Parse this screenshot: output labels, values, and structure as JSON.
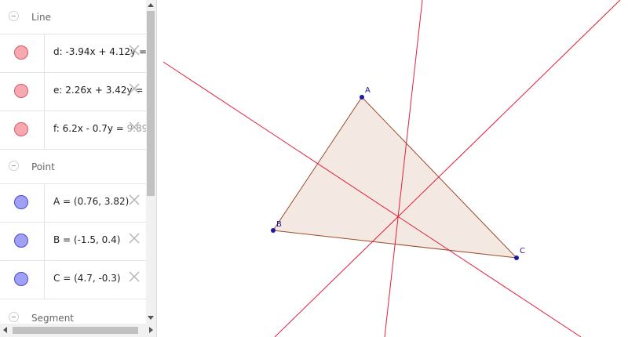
{
  "algebra": {
    "groups": [
      {
        "title": "Line",
        "items": [
          {
            "text": "d: -3.94x + 4.12y = ",
            "faded": "",
            "color": "#f08c96"
          },
          {
            "text": "e: 2.26x + 3.42y = ",
            "faded": "",
            "color": "#f08c96"
          },
          {
            "text": "f: 6.2x - 0.7y = ",
            "faded": "9.89",
            "color": "#f08c96"
          }
        ]
      },
      {
        "title": "Point",
        "items": [
          {
            "text": "A = (0.76, 3.82)",
            "faded": "",
            "color": "#8c8cf0"
          },
          {
            "text": "B = (-1.5, 0.4)",
            "faded": "",
            "color": "#8c8cf0"
          },
          {
            "text": "C = (4.7, -0.3)",
            "faded": "",
            "color": "#8c8cf0"
          }
        ]
      },
      {
        "title": "Segment",
        "items": []
      }
    ]
  },
  "graphics": {
    "points": [
      {
        "label": "A"
      },
      {
        "label": "B"
      },
      {
        "label": "C"
      }
    ],
    "colors": {
      "line": "#e0203c",
      "point": "#1a1aa6",
      "polygon_fill": "#f3e6e0",
      "polygon_stroke": "#9c4a2a"
    }
  }
}
